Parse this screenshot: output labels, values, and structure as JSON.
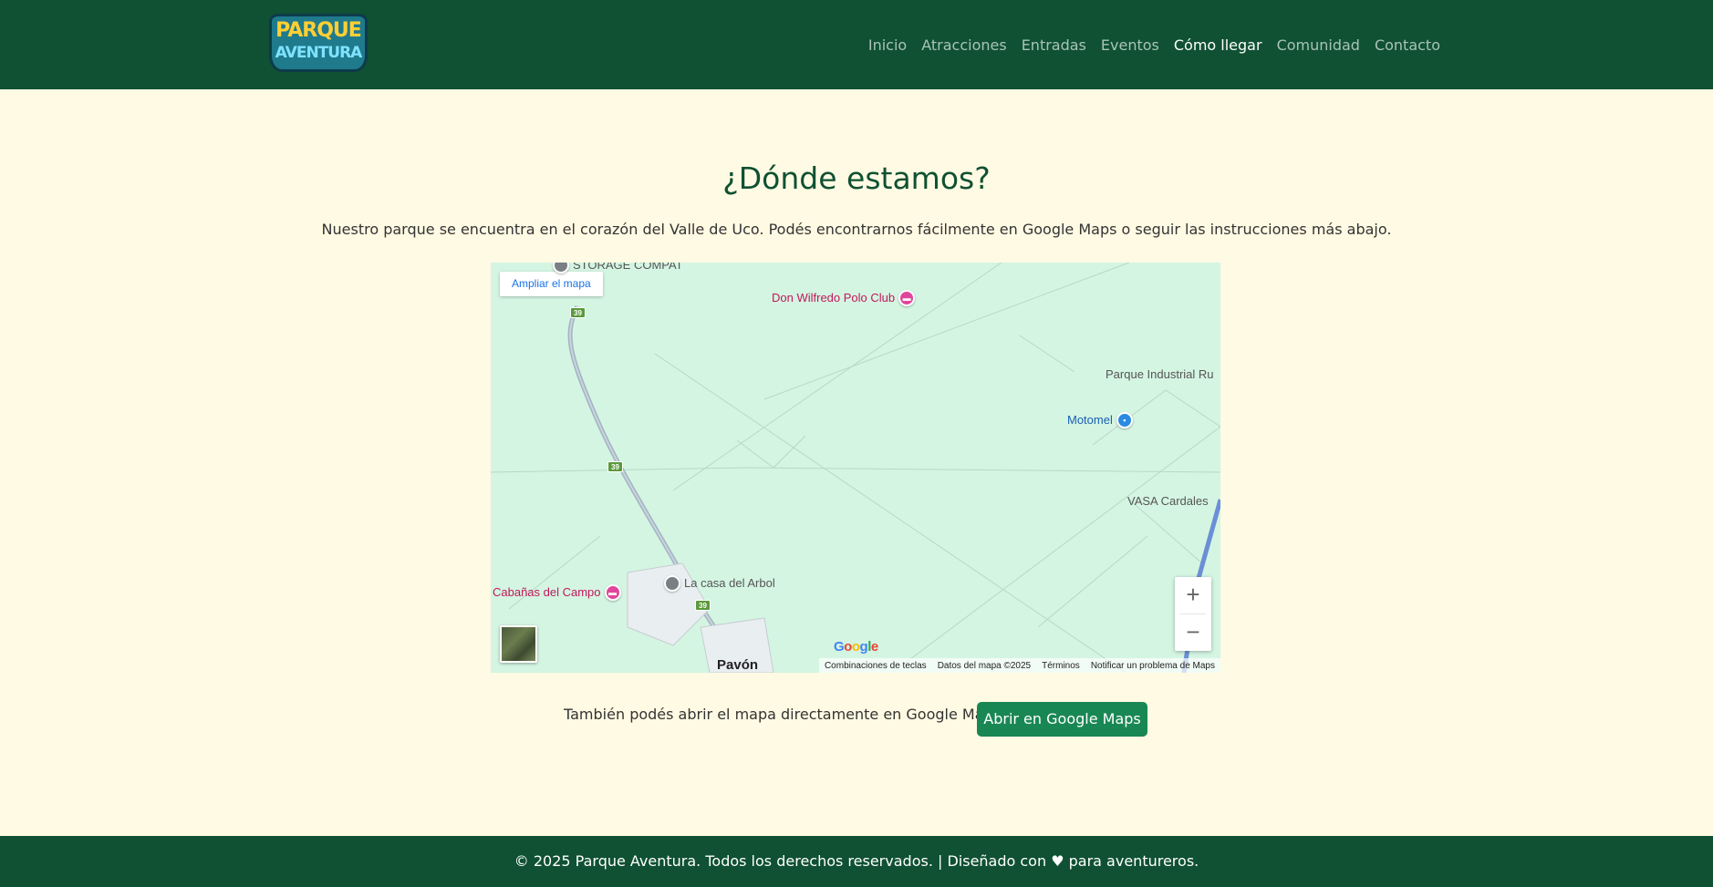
{
  "brand": {
    "logo_line1": "PARQUE",
    "logo_line2": "AVENTURA"
  },
  "nav": {
    "items": [
      "Inicio",
      "Atracciones",
      "Entradas",
      "Eventos",
      "Cómo llegar",
      "Comunidad",
      "Contacto"
    ],
    "active": "Cómo llegar"
  },
  "main": {
    "title": "¿Dónde estamos?",
    "intro": "Nuestro parque se encuentra en el corazón del Valle de Uco. Podés encontrarnos fácilmente en Google Maps o seguir las instrucciones más abajo.",
    "also_text": "También podés abrir el mapa directamente en Google Maps:",
    "open_button": "Abrir en Google Maps"
  },
  "map": {
    "enlarge_label": "Ampliar el mapa",
    "places": {
      "storage": "STORAGE COMPAT",
      "polo_club": "Don Wilfredo Polo Club",
      "industrial": "Parque Industrial Ru",
      "motomel": "Motomel",
      "vasa": "VASA Cardales",
      "cabanas": "Cabañas del Campo",
      "casa_arbol": "La casa del Arbol",
      "pavon": "Pavón"
    },
    "route_shield": "39",
    "zoom_in": "+",
    "zoom_out": "−",
    "google_logo": [
      "G",
      "o",
      "o",
      "g",
      "l",
      "e"
    ],
    "attribution": {
      "shortcuts": "Combinaciones de teclas",
      "data": "Datos del mapa ©2025",
      "terms": "Términos",
      "report": "Notificar un problema de Maps"
    }
  },
  "footer": {
    "text": "© 2025 Parque Aventura. Todos los derechos reservados. | Diseñado con ♥ para aventureros."
  },
  "colors": {
    "header_bg": "#0f5132",
    "page_bg": "#fffae3",
    "title": "#0f5132",
    "button": "#198754",
    "map_land": "#d4f5e2"
  }
}
